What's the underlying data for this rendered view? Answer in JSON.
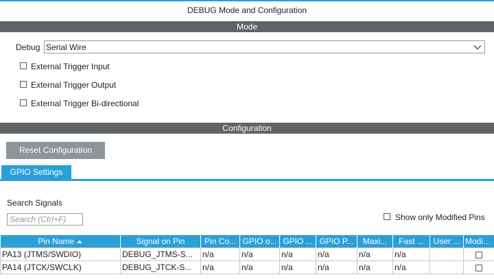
{
  "window": {
    "title": "DEBUG Mode and Configuration"
  },
  "mode": {
    "section_title": "Mode",
    "debug_label": "Debug",
    "debug_value": "Serial Wire",
    "options": [
      {
        "label": "External Trigger Input",
        "checked": false
      },
      {
        "label": "External Trigger Output",
        "checked": false
      },
      {
        "label": "External Trigger Bi-directional",
        "checked": false
      }
    ]
  },
  "configuration": {
    "section_title": "Configuration",
    "reset_label": "Reset Configuration",
    "tabs": [
      {
        "label": "GPIO Settings",
        "active": true
      }
    ],
    "search_label": "Search Signals",
    "search_placeholder": "Search (Ctrl+F)",
    "show_modified_label": "Show only Modified Pins",
    "show_modified_checked": false
  },
  "table": {
    "columns": [
      "Pin Name",
      "Signal on Pin",
      "Pin Co...",
      "GPIO o...",
      "GPIO ...",
      "GPIO P...",
      "Maxi...",
      "Fast ...",
      "User ...",
      "Modifi..."
    ],
    "rows": [
      [
        "PA13 (JTMS/SWDIO)",
        "DEBUG_JTMS-S...",
        "n/a",
        "n/a",
        "n/a",
        "n/a",
        "n/a",
        "n/a",
        "",
        ""
      ],
      [
        "PA14 (JTCK/SWCLK)",
        "DEBUG_JTCK-S...",
        "n/a",
        "n/a",
        "n/a",
        "n/a",
        "n/a",
        "n/a",
        "",
        ""
      ]
    ]
  },
  "colors": {
    "accent": "#2a9fd8",
    "section_bar": "#5f6468",
    "button": "#8e9497"
  },
  "icons": {
    "dropdown": "chevron-down-icon",
    "sort": "sort-ascending-icon"
  }
}
